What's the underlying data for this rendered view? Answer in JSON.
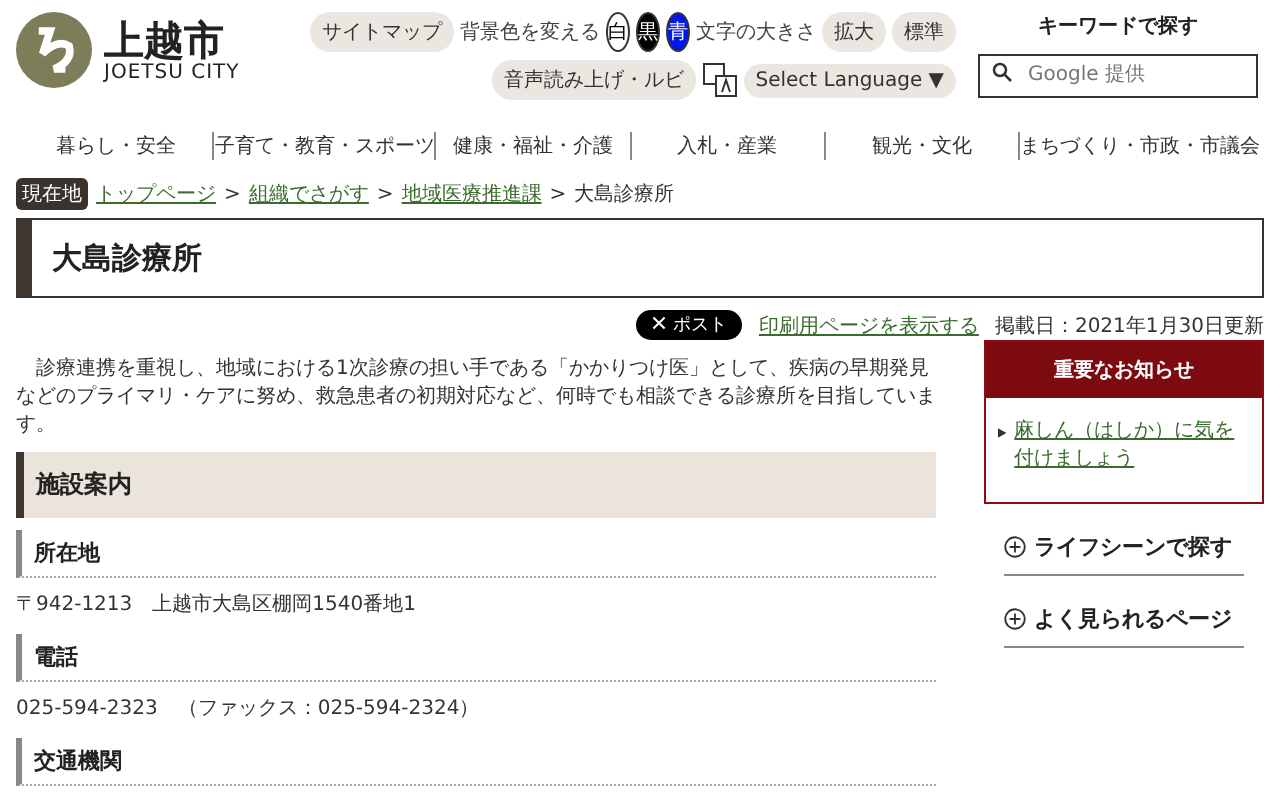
{
  "logo": {
    "name": "上越市",
    "sub": "JOETSU CITY"
  },
  "header_links": {
    "sitemap": "サイトマップ",
    "bg_label": "背景色を変える",
    "bg_options": [
      {
        "label": "白",
        "kind": "white"
      },
      {
        "label": "黒",
        "kind": "black"
      },
      {
        "label": "青",
        "kind": "blue"
      }
    ],
    "size_label": "文字の大きさ",
    "size_options": [
      "拡大",
      "標準"
    ],
    "speech": "音声読み上げ・ルビ",
    "language": "Select Language ▼"
  },
  "search": {
    "title": "キーワードで探す",
    "placeholder": "Google 提供"
  },
  "nav": [
    "暮らし・安全",
    "子育て・教育・スポーツ",
    "健康・福祉・介護",
    "入札・産業",
    "観光・文化",
    "まちづくり・市政・市議会"
  ],
  "breadcrumb": {
    "label": "現在地",
    "links": [
      "トップページ",
      "組織でさがす",
      "地域医療推進課"
    ],
    "current": "大島診療所",
    "separator": ">"
  },
  "page_title": "大島診療所",
  "meta": {
    "post": "ポスト",
    "print": "印刷用ページを表示する",
    "date": "掲載日：2021年1月30日更新"
  },
  "intro": "診療連携を重視し、地域における1次診療の担い手である「かかりつけ医」として、疾病の早期発見などのプライマリ・ケアに努め、救急患者の初期対応など、何時でも相談できる診療所を目指しています。",
  "section": "施設案内",
  "items": [
    {
      "heading": "所在地",
      "text": "〒942-1213　上越市大島区棚岡1540番地1"
    },
    {
      "heading": "電話",
      "text": "025-594-2323　（ファックス：025-594-2324）"
    },
    {
      "heading": "交通機関"
    }
  ],
  "notice": {
    "title": "重要なお知らせ",
    "links": [
      "麻しん（はしか）に気を付けましょう"
    ]
  },
  "side_menu": [
    "ライフシーンで探す",
    "よく見られるページ"
  ]
}
